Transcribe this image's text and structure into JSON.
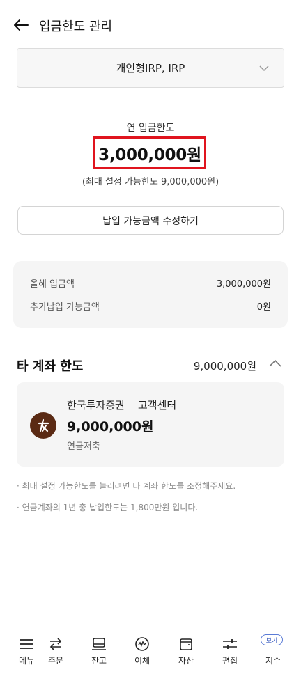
{
  "header": {
    "title": "입금한도 관리"
  },
  "account": {
    "selected": "개인형IRP, IRP"
  },
  "limit": {
    "caption": "연 입금한도",
    "amount": "3,000,000원",
    "max_note": "(최대 설정 가능한도 9,000,000원)",
    "edit_button": "납입 가능금액 수정하기"
  },
  "summary": {
    "rows": [
      {
        "label": "올해 입금액",
        "value": "3,000,000원"
      },
      {
        "label": "추가납입 가능금액",
        "value": "0원"
      }
    ]
  },
  "other_accounts": {
    "title": "타 계좌 한도",
    "total": "9,000,000원",
    "items": [
      {
        "broker": "한국투자증권",
        "link": "고객센터",
        "amount": "9,000,000원",
        "product": "연금저축"
      }
    ]
  },
  "notes": [
    "· 최대 설정 가능한도를 늘리려면 타 계좌 한도를 조정해주세요.",
    "· 연금계좌의 1년 총 납입한도는 1,800만원 입니다."
  ],
  "tabbar": {
    "items": [
      {
        "label": "메뉴",
        "icon": "menu-icon"
      },
      {
        "label": "주문",
        "icon": "order-arrows-icon"
      },
      {
        "label": "잔고",
        "icon": "balance-icon"
      },
      {
        "label": "이체",
        "icon": "transfer-icon"
      },
      {
        "label": "자산",
        "icon": "wallet-icon"
      },
      {
        "label": "편집",
        "icon": "edit-sliders-icon"
      },
      {
        "label": "지수",
        "icon": "index-badge-icon",
        "badge": "보기"
      }
    ]
  },
  "colors": {
    "highlight_border": "#e0141e",
    "logo_bg": "#5a2a14",
    "badge": "#3a5bbf"
  }
}
